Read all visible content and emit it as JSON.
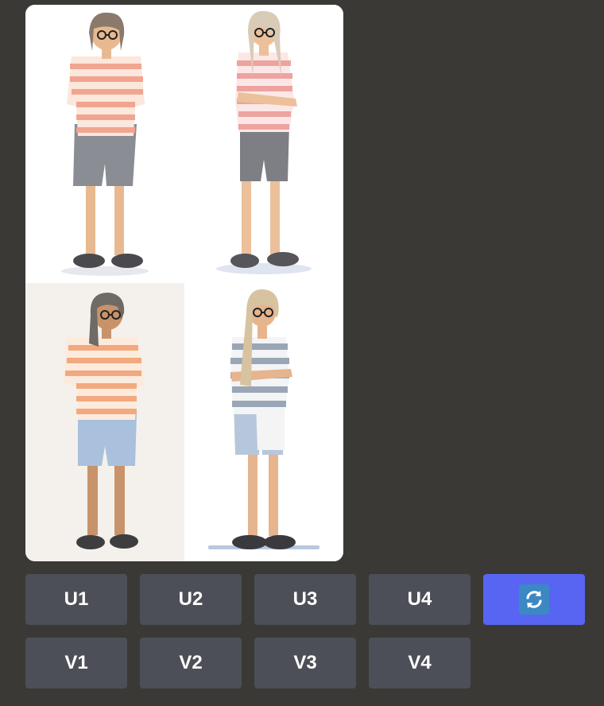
{
  "image_grid": {
    "tiles": [
      {
        "shirt": "#f0a590",
        "shorts": "#8a8d93",
        "hair": "#8b7a6b",
        "background": "#ffffff"
      },
      {
        "shirt": "#eda3a0",
        "shorts": "#7d7f84",
        "hair": "#d9cbb6",
        "background": "#ffffff"
      },
      {
        "shirt": "#f2a97f",
        "shorts": "#a9c1dc",
        "hair": "#6f6a66",
        "background": "#f4f1ec"
      },
      {
        "shirt": "#9aa6b5",
        "shorts": "#b6c7dc",
        "hair": "#d8c3a0",
        "background": "#ffffff"
      }
    ]
  },
  "buttons": {
    "upscale": [
      "U1",
      "U2",
      "U3",
      "U4"
    ],
    "variation": [
      "V1",
      "V2",
      "V3",
      "V4"
    ],
    "reroll_icon": "refresh-icon"
  },
  "colors": {
    "background": "#3a3935",
    "button": "#4d4f58",
    "button_primary": "#5865f2"
  }
}
